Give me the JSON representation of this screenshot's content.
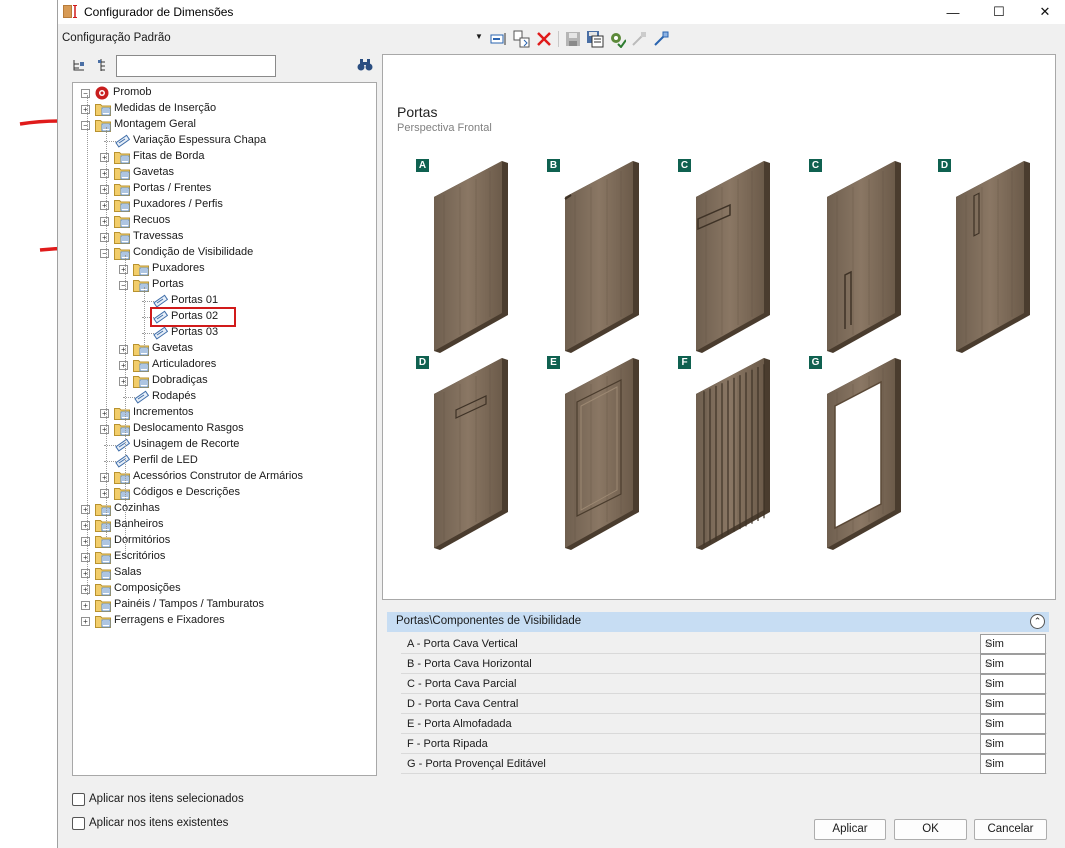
{
  "window": {
    "title": "Configurador de Dimensões",
    "min_glyph": "—",
    "max_glyph": "☐",
    "close_glyph": "✕"
  },
  "toolbar": {
    "configuration": "Configuração Padrão",
    "dropdown_glyph": "▼"
  },
  "tree": {
    "root": "Promob",
    "items": [
      {
        "label": "Medidas de Inserção",
        "expander": "+"
      },
      {
        "label": "Montagem Geral",
        "expander": "−"
      },
      {
        "label": "Variação Espessura Chapa",
        "expander": ""
      },
      {
        "label": "Fitas de Borda",
        "expander": "+"
      },
      {
        "label": "Gavetas",
        "expander": "+"
      },
      {
        "label": "Portas / Frentes",
        "expander": "+"
      },
      {
        "label": "Puxadores / Perfis",
        "expander": "+"
      },
      {
        "label": "Recuos",
        "expander": "+"
      },
      {
        "label": "Travessas",
        "expander": "+"
      },
      {
        "label": "Condição de Visibilidade",
        "expander": "−"
      },
      {
        "label": "Puxadores",
        "expander": "+"
      },
      {
        "label": "Portas",
        "expander": "−"
      },
      {
        "label": "Portas 01",
        "expander": ""
      },
      {
        "label": "Portas 02",
        "expander": ""
      },
      {
        "label": "Portas 03",
        "expander": ""
      },
      {
        "label": "Gavetas",
        "expander": "+"
      },
      {
        "label": "Articuladores",
        "expander": "+"
      },
      {
        "label": "Dobradiças",
        "expander": "+"
      },
      {
        "label": "Rodapés",
        "expander": ""
      },
      {
        "label": "Incrementos",
        "expander": "+"
      },
      {
        "label": "Deslocamento Rasgos",
        "expander": "+"
      },
      {
        "label": "Usinagem de Recorte",
        "expander": ""
      },
      {
        "label": "Perfil de LED",
        "expander": ""
      },
      {
        "label": "Acessórios Construtor de Armários",
        "expander": "+"
      },
      {
        "label": "Códigos e Descrições",
        "expander": "+"
      },
      {
        "label": "Cozinhas",
        "expander": "+"
      },
      {
        "label": "Banheiros",
        "expander": "+"
      },
      {
        "label": "Dormitórios",
        "expander": "+"
      },
      {
        "label": "Escritórios",
        "expander": "+"
      },
      {
        "label": "Salas",
        "expander": "+"
      },
      {
        "label": "Composições",
        "expander": "+"
      },
      {
        "label": "Painéis / Tampos / Tamburatos",
        "expander": "+"
      },
      {
        "label": "Ferragens e Fixadores",
        "expander": "+"
      }
    ]
  },
  "preview": {
    "title": "Portas",
    "subtitle": "Perspectiva Frontal",
    "doors": [
      {
        "tag": "A"
      },
      {
        "tag": "B"
      },
      {
        "tag": "C"
      },
      {
        "tag": "C"
      },
      {
        "tag": "D"
      },
      {
        "tag": "D"
      },
      {
        "tag": "E"
      },
      {
        "tag": "F"
      },
      {
        "tag": "G"
      }
    ]
  },
  "properties": {
    "group_title": "Portas\\Componentes de Visibilidade",
    "collapse_glyph": "⌃",
    "rows": [
      {
        "name": "A - Porta Cava Vertical",
        "value": "Sim"
      },
      {
        "name": "B - Porta Cava Horizontal",
        "value": "Sim"
      },
      {
        "name": "C - Porta Cava Parcial",
        "value": "Sim"
      },
      {
        "name": "D - Porta Cava Central",
        "value": "Sim"
      },
      {
        "name": "E - Porta Almofadada",
        "value": "Sim"
      },
      {
        "name": "F - Porta Ripada",
        "value": "Sim"
      },
      {
        "name": "G - Porta Provençal Editável",
        "value": "Sim"
      }
    ],
    "dropdown_glyph": "⌵"
  },
  "options": {
    "apply_selected": "Aplicar nos itens selecionados",
    "apply_existing": "Aplicar nos itens existentes"
  },
  "buttons": {
    "apply": "Aplicar",
    "ok": "OK",
    "cancel": "Cancelar"
  },
  "colors": {
    "tag_green": "#0f6150",
    "wood": "#7a6a58",
    "group_header": "#c7ddf3",
    "highlight_red": "#d11a1a"
  }
}
